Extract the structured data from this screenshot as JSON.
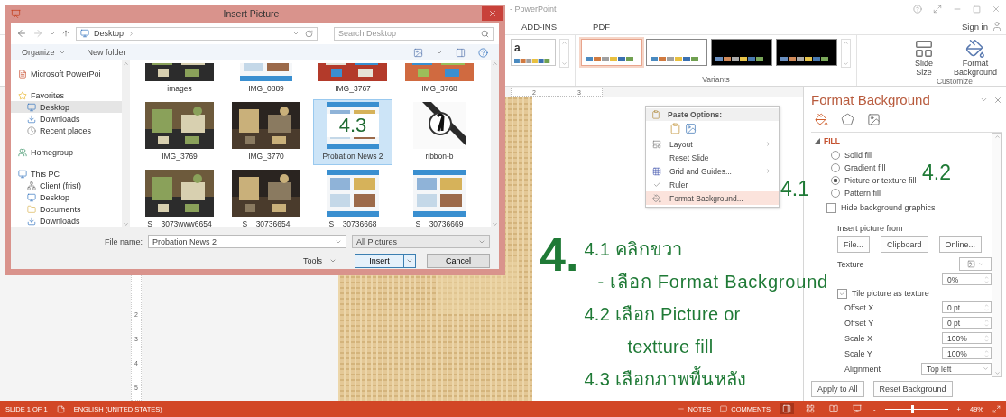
{
  "powerpoint": {
    "title": "- PowerPoint",
    "tabs": [
      {
        "label": "ADD-INS",
        "selected": false
      },
      {
        "label": "PDF",
        "selected": false
      }
    ],
    "sign_in": "Sign in"
  },
  "ribbon": {
    "theme_letter": "a",
    "variants": [
      {
        "kind": "light",
        "selected": true
      },
      {
        "kind": "light",
        "selected": false
      },
      {
        "kind": "dark",
        "selected": false
      },
      {
        "kind": "dark",
        "selected": false
      }
    ],
    "variants_label": "Variants",
    "customize": [
      {
        "kind": "slide-size",
        "label": "Slide Size"
      },
      {
        "kind": "format-background",
        "label": "Format Background"
      }
    ],
    "customize_label": "Customize"
  },
  "ruler": {
    "horizontal": [
      "2",
      "3"
    ],
    "vertical": [
      "2",
      "3",
      "4",
      "5"
    ]
  },
  "dialog": {
    "title": "Insert Picture",
    "address": "Desktop",
    "search_placeholder": "Search Desktop",
    "toolbar": [
      "Organize",
      "New folder"
    ],
    "nav": [
      {
        "label": "Microsoft PowerPoi",
        "kind": "app",
        "selected": false
      },
      {
        "label": "Favorites",
        "kind": "favorites",
        "selected": false
      },
      {
        "label": "Desktop",
        "kind": "desktop",
        "selected": true
      },
      {
        "label": "Downloads",
        "kind": "downloads",
        "selected": false
      },
      {
        "label": "Recent places",
        "kind": "recent",
        "selected": false
      },
      {
        "label": "Homegroup",
        "kind": "homegroup",
        "selected": false
      },
      {
        "label": "This PC",
        "kind": "pc",
        "selected": false
      },
      {
        "label": "Client (frist)",
        "kind": "network",
        "selected": false
      },
      {
        "label": "Desktop",
        "kind": "desktop",
        "selected": false
      },
      {
        "label": "Documents",
        "kind": "documents",
        "selected": false
      },
      {
        "label": "Downloads",
        "kind": "downloads",
        "selected": false
      }
    ],
    "files": [
      {
        "name": "images",
        "selected": false
      },
      {
        "name": "IMG_0889",
        "kind": "document",
        "selected": false
      },
      {
        "name": "IMG_3767",
        "selected": false
      },
      {
        "name": "IMG_3768",
        "selected": false
      },
      {
        "name": "IMG_3769",
        "selected": false
      },
      {
        "name": "IMG_3770",
        "selected": false
      },
      {
        "name": "Probation News 2",
        "kind": "document",
        "selected": true,
        "overlay": "4.3"
      },
      {
        "name": "ribbon-b",
        "kind": "ribbon",
        "selected": false
      },
      {
        "name": "S__3073www6654",
        "selected": false
      },
      {
        "name": "S__30736654",
        "selected": false
      },
      {
        "name": "S__30736668",
        "kind": "document",
        "selected": false
      },
      {
        "name": "S__30736669",
        "kind": "document",
        "selected": false
      }
    ],
    "file_name_label": "File name:",
    "file_name": "Probation News 2",
    "filter": "All Pictures",
    "tools": "Tools",
    "insert": "Insert",
    "cancel": "Cancel"
  },
  "context_menu": {
    "header": "Paste Options:",
    "items": [
      {
        "label": "Layout",
        "kind": "layout",
        "submenu": true,
        "checked": false,
        "highlighted": false
      },
      {
        "label": "Reset Slide",
        "kind": "plain",
        "submenu": false,
        "checked": false,
        "highlighted": false
      },
      {
        "label": "Grid and Guides...",
        "kind": "grid",
        "submenu": true,
        "checked": false,
        "highlighted": false
      },
      {
        "label": "Ruler",
        "kind": "plain",
        "submenu": false,
        "checked": true,
        "highlighted": false
      },
      {
        "label": "Format Background...",
        "kind": "format",
        "submenu": false,
        "checked": false,
        "highlighted": true
      }
    ],
    "annotation": "4.1"
  },
  "panel": {
    "title": "Format Background",
    "section": "FILL",
    "fill_options": [
      {
        "label": "Solid fill",
        "selected": false
      },
      {
        "label": "Gradient fill",
        "selected": false
      },
      {
        "label": "Picture or texture fill",
        "selected": true
      },
      {
        "label": "Pattern fill",
        "selected": false
      }
    ],
    "hide_graphics": {
      "label": "Hide background graphics",
      "checked": false
    },
    "insert_from": "Insert picture from",
    "sources": [
      "File...",
      "Clipboard",
      "Online..."
    ],
    "texture": "Texture",
    "transparency_value": "0%",
    "tile": {
      "label": "Tile picture as texture",
      "checked": true
    },
    "fields": [
      {
        "label": "Offset X",
        "value": "0 pt"
      },
      {
        "label": "Offset Y",
        "value": "0 pt"
      },
      {
        "label": "Scale X",
        "value": "100%"
      },
      {
        "label": "Scale Y",
        "value": "100%"
      }
    ],
    "alignment": {
      "label": "Alignment",
      "value": "Top left"
    },
    "buttons": [
      "Apply to All",
      "Reset Background"
    ],
    "annotation": "4.2"
  },
  "annotations": {
    "big": "4.",
    "lines": [
      {
        "text": "4.1 คลิกขวา",
        "kind": "step"
      },
      {
        "text": "- เลือก Format Background",
        "kind": "sub"
      },
      {
        "text": "4.2 เลือก Picture or",
        "kind": "step"
      },
      {
        "text": "textture fill",
        "kind": "cont"
      },
      {
        "text": "4.3 เลือกภาพพื้นหลัง",
        "kind": "step"
      }
    ]
  },
  "status_bar": {
    "slide": "SLIDE 1 OF 1",
    "language": "ENGLISH (UNITED STATES)",
    "notes": "NOTES",
    "comments": "COMMENTS",
    "views": [
      {
        "kind": "normal",
        "selected": true
      },
      {
        "kind": "sorter",
        "selected": false
      },
      {
        "kind": "reading",
        "selected": false
      },
      {
        "kind": "show",
        "selected": false
      }
    ],
    "zoom_out": "-",
    "zoom_in": "+",
    "zoom": {
      "level": 0.42
    },
    "zoom_value": "49%"
  }
}
